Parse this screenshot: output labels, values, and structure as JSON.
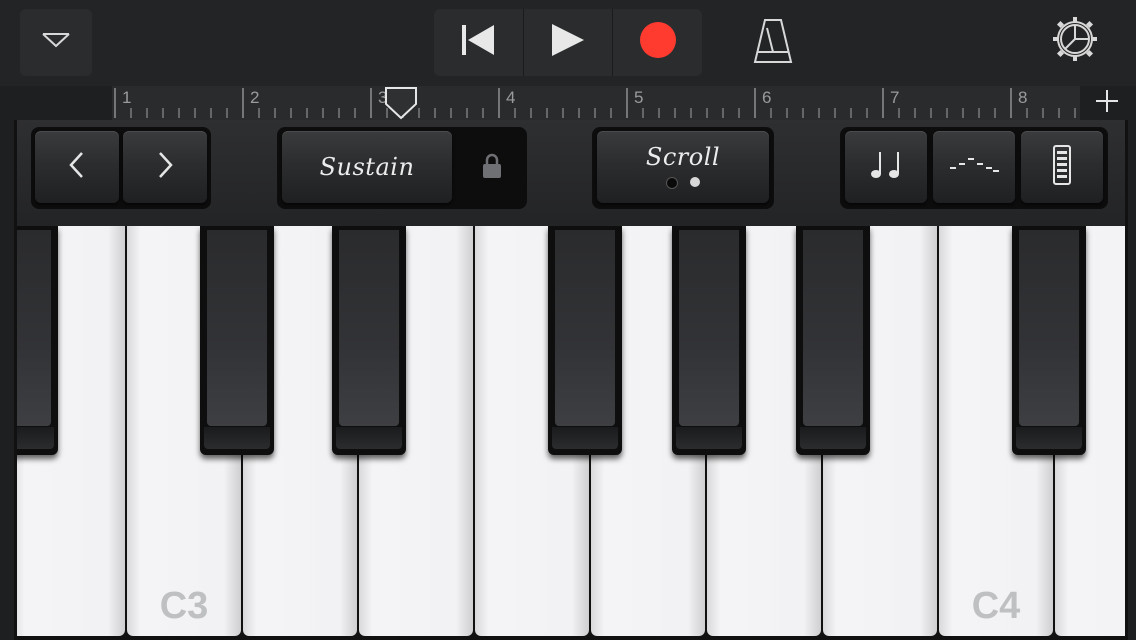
{
  "toolbar": {
    "menu_icon": "chevron-down-outline",
    "transport": {
      "rewind_icon": "go-to-beginning",
      "play_icon": "play-triangle",
      "record_icon": "record-circle",
      "record_color": "#ff3b30"
    },
    "metronome_icon": "metronome",
    "settings_icon": "gear"
  },
  "ruler": {
    "bars": [
      "1",
      "2",
      "3",
      "4",
      "5",
      "6",
      "7",
      "8"
    ],
    "playhead_bar": 3.2,
    "add_icon": "plus"
  },
  "controls": {
    "octave_down_icon": "chevron-left",
    "octave_up_icon": "chevron-right",
    "sustain_label": "Sustain",
    "sustain_lock_icon": "lock",
    "scroll_label": "Scroll",
    "scroll_active_index": 1,
    "glissando_icon": "eighth-notes",
    "arpeggiator_icon": "arpeggio-dashes",
    "velocity_icon": "velocity-meter"
  },
  "keyboard": {
    "labels": [
      "C3",
      "C4"
    ],
    "white_key_color": "#f2f2f4",
    "black_key_color": "#0e0e0f"
  }
}
